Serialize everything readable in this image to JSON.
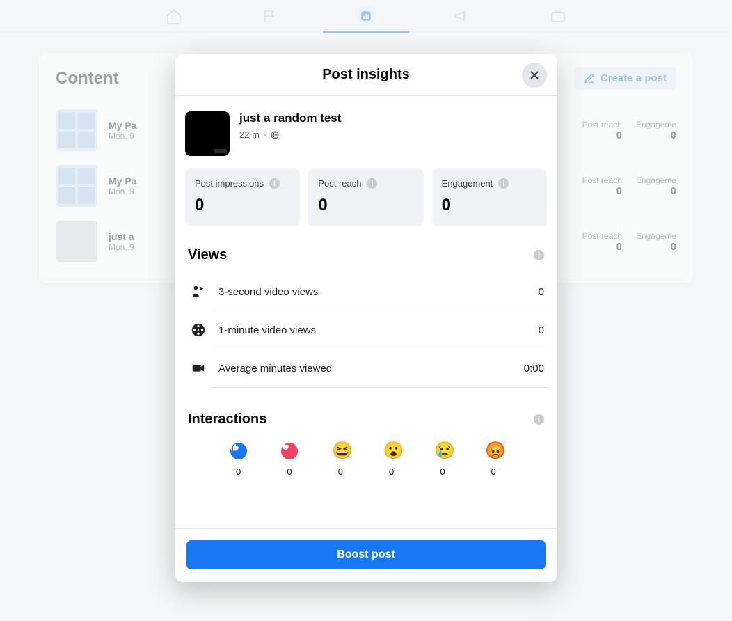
{
  "page": {
    "title": "Content",
    "create_button": "Create a post",
    "posts": [
      {
        "name": "My Pa",
        "date": "Mon, 9",
        "reach_label": "Post reach",
        "reach": "0",
        "eng_label": "Engageme",
        "eng": "0",
        "thumb": "window"
      },
      {
        "name": "My Pa",
        "date": "Mon, 9",
        "reach_label": "Post reach",
        "reach": "0",
        "eng_label": "Engageme",
        "eng": "0",
        "thumb": "window"
      },
      {
        "name": "just a",
        "date": "Mon, 9",
        "reach_label": "Post reach",
        "reach": "0",
        "eng_label": "Engageme",
        "eng": "0",
        "thumb": "gray"
      }
    ]
  },
  "modal": {
    "title": "Post insights",
    "post_title": "just a random test",
    "post_time": "22 m",
    "stats": [
      {
        "label": "Post impressions",
        "value": "0"
      },
      {
        "label": "Post reach",
        "value": "0"
      },
      {
        "label": "Engagement",
        "value": "0"
      }
    ],
    "views_title": "Views",
    "views": [
      {
        "label": "3-second video views",
        "value": "0"
      },
      {
        "label": "1-minute video views",
        "value": "0"
      },
      {
        "label": "Average minutes viewed",
        "value": "0:00"
      }
    ],
    "interactions_title": "Interactions",
    "reactions": [
      {
        "name": "like",
        "count": "0"
      },
      {
        "name": "love",
        "count": "0"
      },
      {
        "name": "haha",
        "count": "0"
      },
      {
        "name": "wow",
        "count": "0"
      },
      {
        "name": "sad",
        "count": "0"
      },
      {
        "name": "angry",
        "count": "0"
      }
    ],
    "boost_label": "Boost post"
  }
}
